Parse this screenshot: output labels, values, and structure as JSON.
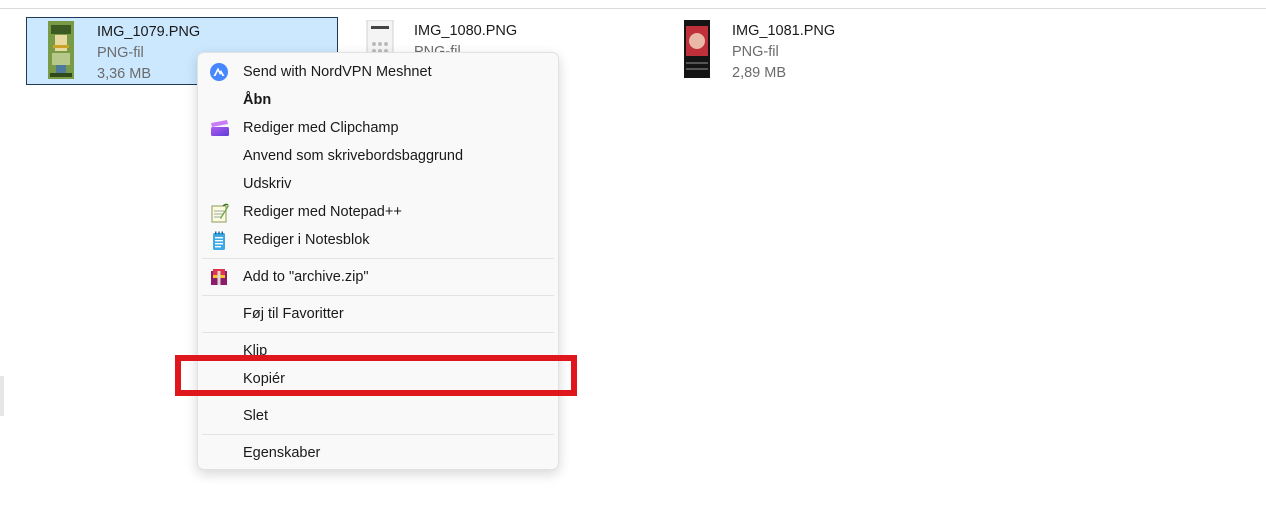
{
  "files": [
    {
      "name": "IMG_1079.PNG",
      "type": "PNG-fil",
      "size": "3,36 MB",
      "selected": true
    },
    {
      "name": "IMG_1080.PNG",
      "type": "PNG-fil",
      "size": "",
      "selected": false
    },
    {
      "name": "IMG_1081.PNG",
      "type": "PNG-fil",
      "size": "2,89 MB",
      "selected": false
    }
  ],
  "context_menu": {
    "items": [
      {
        "label": "Send with NordVPN Meshnet",
        "icon": "nordvpn-icon"
      },
      {
        "label": "Åbn",
        "bold": true
      },
      {
        "label": "Rediger med Clipchamp",
        "icon": "clipchamp-icon"
      },
      {
        "label": "Anvend som skrivebordsbaggrund"
      },
      {
        "label": "Udskriv"
      },
      {
        "label": "Rediger med Notepad++",
        "icon": "notepadpp-icon"
      },
      {
        "label": "Rediger i Notesblok",
        "icon": "notepad-icon"
      },
      {
        "label": "Add to \"archive.zip\"",
        "icon": "winrar-icon"
      },
      {
        "label": "Føj til Favoritter"
      },
      {
        "label": "Klip"
      },
      {
        "label": "Kopiér",
        "highlighted": true
      },
      {
        "label": "Slet"
      },
      {
        "label": "Egenskaber"
      }
    ]
  },
  "colors": {
    "selection_bg": "#cce8ff",
    "highlight_box": "#e0161d",
    "menu_bg": "#f9f9f9"
  }
}
